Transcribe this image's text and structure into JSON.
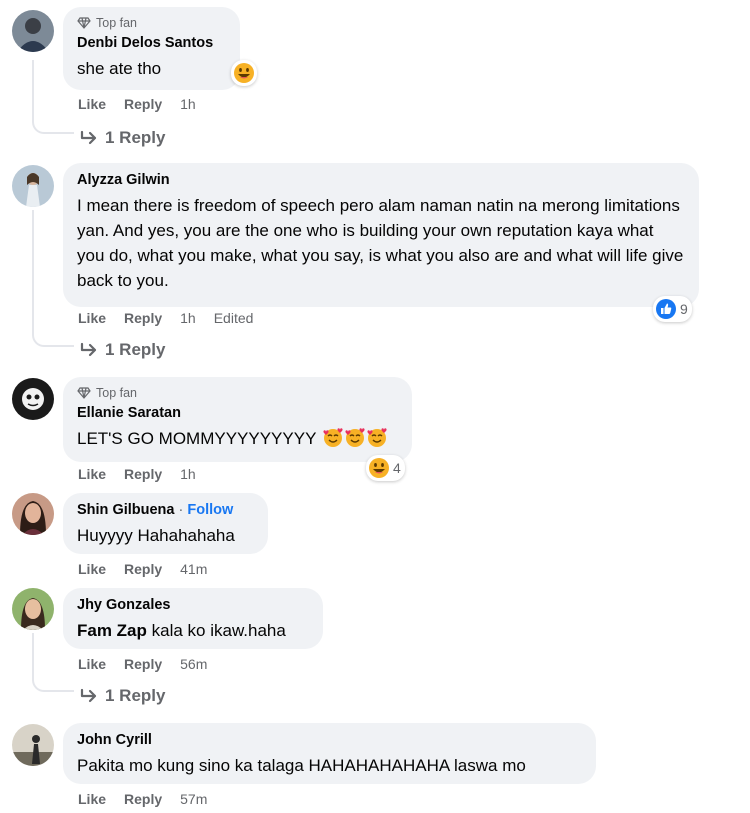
{
  "comments": [
    {
      "badge": "Top fan",
      "author": "Denbi Delos Santos",
      "text": "she ate tho",
      "actions": {
        "like": "Like",
        "reply": "Reply",
        "time": "1h"
      },
      "reaction_icon": "grinning-emoji",
      "replies_label": "1 Reply"
    },
    {
      "author": "Alyzza Gilwin",
      "text": "I mean there is freedom of speech pero alam naman natin na merong limitations yan. And yes, you are the one who is building your own reputation kaya what you do, what you make, what you say, is what you also are and what will life give back to you.",
      "actions": {
        "like": "Like",
        "reply": "Reply",
        "time": "1h",
        "edited": "Edited"
      },
      "reaction_icon": "like-icon",
      "reaction_count": "9",
      "replies_label": "1 Reply"
    },
    {
      "badge": "Top fan",
      "author": "Ellanie Saratan",
      "text": "LET'S GO MOMMYYYYYYYYY",
      "text_emojis": [
        "smiling-face-with-hearts-emoji",
        "smiling-face-with-hearts-emoji",
        "smiling-face-with-hearts-emoji"
      ],
      "actions": {
        "like": "Like",
        "reply": "Reply",
        "time": "1h"
      },
      "reaction_icon": "grinning-emoji",
      "reaction_count": "4"
    },
    {
      "author": "Shin Gilbuena",
      "separator": "·",
      "follow": "Follow",
      "text": "Huyyyy Hahahahaha",
      "actions": {
        "like": "Like",
        "reply": "Reply",
        "time": "41m"
      }
    },
    {
      "author": "Jhy Gonzales",
      "mention": "Fam Zap",
      "text": " kala ko ikaw.haha",
      "actions": {
        "like": "Like",
        "reply": "Reply",
        "time": "56m"
      },
      "replies_label": "1 Reply"
    },
    {
      "author": "John Cyrill",
      "text": "Pakita mo kung sino ka talaga HAHAHAHAHAHA laswa mo",
      "actions": {
        "like": "Like",
        "reply": "Reply",
        "time": "57m"
      }
    }
  ],
  "colors": {
    "bubble": "#f0f2f5",
    "meta_text": "#65676b",
    "link_blue": "#1877f2",
    "thread_line": "#e4e6eb"
  }
}
